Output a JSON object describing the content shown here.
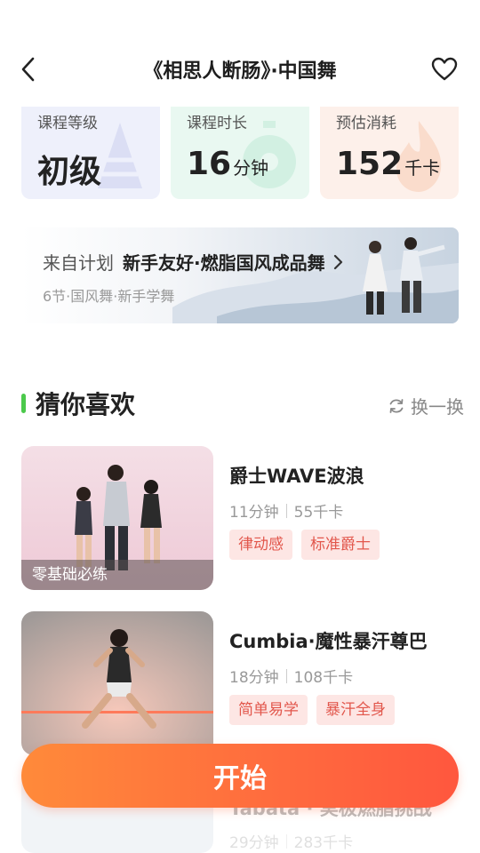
{
  "header": {
    "title": "《相思人断肠》·中国舞",
    "back_icon": "chevron-left-icon",
    "favorite_icon": "heart-outline-icon"
  },
  "stats": [
    {
      "label": "课程等级",
      "value": "初级",
      "unit": "",
      "bg": "#eef0fb"
    },
    {
      "label": "课程时长",
      "value": "16",
      "unit": "分钟",
      "bg": "#e9f8f1"
    },
    {
      "label": "预估消耗",
      "value": "152",
      "unit": "千卡",
      "bg": "#fdf0ea"
    }
  ],
  "plan": {
    "prefix": "来自计划",
    "name": "新手友好·燃脂国风成品舞",
    "subtitle": "6节·国风舞·新手学舞"
  },
  "recommend": {
    "title": "猜你喜欢",
    "refresh_label": "换一换",
    "accent": "#4bc94b",
    "items": [
      {
        "title": "爵士WAVE波浪",
        "duration": "11分钟",
        "calories": "55千卡",
        "tags": [
          "律动感",
          "标准爵士"
        ],
        "thumb_tag": "零基础必练"
      },
      {
        "title": "Cumbia·魔性暴汗尊巴",
        "duration": "18分钟",
        "calories": "108千卡",
        "tags": [
          "简单易学",
          "暴汗全身"
        ],
        "thumb_tag": ""
      },
      {
        "title": "Tabata · 実极燃脂挑战",
        "duration": "29分钟",
        "calories": "283千卡",
        "tags": [],
        "thumb_tag": ""
      }
    ]
  },
  "start_button": {
    "label": "开始",
    "color_start": "#ff8a3a",
    "color_end": "#ff573e"
  }
}
